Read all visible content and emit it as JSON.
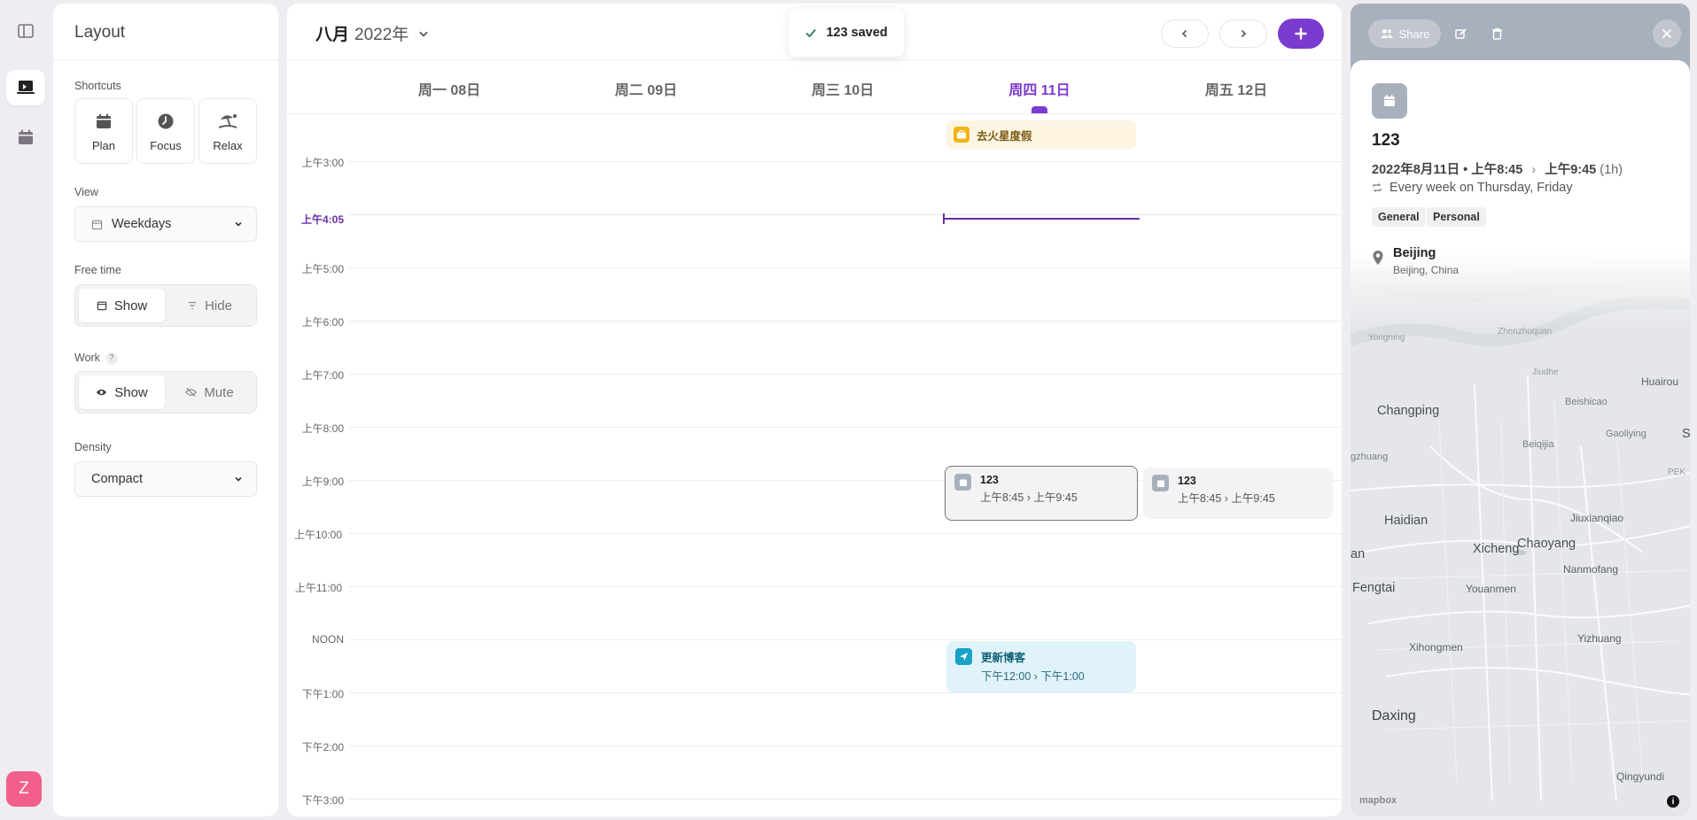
{
  "layout_panel": {
    "title": "Layout",
    "shortcuts_label": "Shortcuts",
    "shortcuts": [
      {
        "label": "Plan",
        "icon": "calendar-icon"
      },
      {
        "label": "Focus",
        "icon": "clock-icon"
      },
      {
        "label": "Relax",
        "icon": "beach-icon"
      }
    ],
    "view_label": "View",
    "view_value": "Weekdays",
    "free_time_label": "Free time",
    "free_time_options": [
      "Show",
      "Hide"
    ],
    "free_time_selected": "Show",
    "work_label": "Work",
    "work_help": "?",
    "work_options": [
      "Show",
      "Mute"
    ],
    "work_selected": "Show",
    "density_label": "Density",
    "density_value": "Compact"
  },
  "rail": {
    "avatar_letter": "Z"
  },
  "calendar": {
    "month": "八月",
    "year": "2022年",
    "days": [
      {
        "label": "周一  08日",
        "today": false
      },
      {
        "label": "周二  09日",
        "today": false
      },
      {
        "label": "周三  10日",
        "today": false
      },
      {
        "label": "周四  11日",
        "today": true
      },
      {
        "label": "周五  12日",
        "today": false
      }
    ],
    "all_day_event": "去火星度假",
    "hour_labels": [
      "上午3:00",
      "上午5:00",
      "上午6:00",
      "上午7:00",
      "上午8:00",
      "上午9:00",
      "上午10:00",
      "上午11:00",
      "NOON",
      "下午1:00",
      "下午2:00",
      "下午3:00"
    ],
    "now_label": "上午4:05",
    "events": [
      {
        "title": "123",
        "time": "上午8:45 › 上午9:45"
      },
      {
        "title": "123",
        "time": "上午8:45 › 上午9:45"
      },
      {
        "title": "更新博客",
        "time": "下午12:00 › 下午1:00"
      }
    ]
  },
  "toast": {
    "text": "123 saved"
  },
  "details": {
    "share_label": "Share",
    "title": "123",
    "date": "2022年8月11日 • 上午8:45",
    "end_time": "上午9:45",
    "duration": "(1h)",
    "repeat": "Every week on Thursday, Friday",
    "tags": [
      "General",
      "Personal"
    ],
    "location_name": "Beijing",
    "location_sub": "Beijing, China",
    "map_labels": [
      "Changping",
      "Haidian",
      "Xicheng",
      "Chaoyang",
      "Fengtai",
      "Daxing",
      "Huairou",
      "Beishicao",
      "Gaoliying",
      "Jiuxianqiao",
      "Nanmofang",
      "Youanmen",
      "Xihongmen",
      "Yizhuang",
      "Qingyundi",
      "Beiqijia",
      "Jiudhe",
      "Zhenzhuquan",
      "Yongning",
      "gzhuang",
      "an",
      "S",
      "PEK"
    ],
    "attribution": "mapbox",
    "info_symbol": "i"
  },
  "colors": {
    "accent": "#7c3bcf",
    "allday_bg": "#fdf5e2",
    "allday_icon": "#f1b414",
    "blog_icon": "#17a2c7",
    "header_gray": "#a9b0bd",
    "avatar": "#f25f8a"
  }
}
